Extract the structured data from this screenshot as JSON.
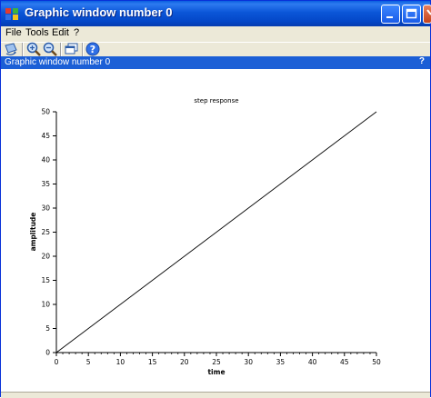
{
  "window": {
    "title": "Graphic window number 0"
  },
  "menu": {
    "items": [
      "File",
      "Tools",
      "Edit",
      "?"
    ]
  },
  "toolbar": {
    "tools": [
      "rotate-icon",
      "zoom-in-icon",
      "zoom-out-icon",
      "window-icon",
      "help-icon"
    ]
  },
  "doc_bar": {
    "title": "Graphic window number 0",
    "help": "?"
  },
  "chart_data": {
    "type": "line",
    "title": "step response",
    "xlabel": "time",
    "ylabel": "amplitude",
    "xlim": [
      0,
      50
    ],
    "ylim": [
      0,
      50
    ],
    "xticks": [
      0,
      5,
      10,
      15,
      20,
      25,
      30,
      35,
      40,
      45,
      50
    ],
    "yticks": [
      0,
      5,
      10,
      15,
      20,
      25,
      30,
      35,
      40,
      45,
      50
    ],
    "grid": false,
    "series": [
      {
        "x": [
          0,
          50
        ],
        "y": [
          0,
          50
        ],
        "color": "#000000"
      }
    ]
  }
}
